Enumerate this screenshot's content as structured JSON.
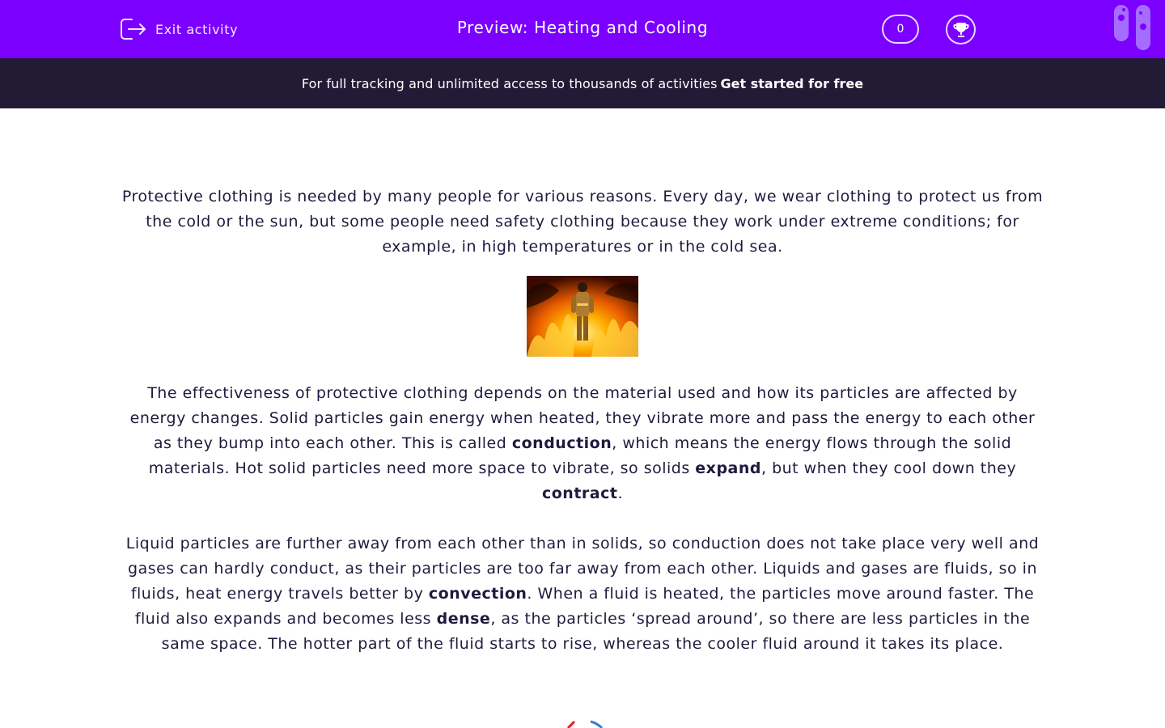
{
  "header": {
    "exit_label": "Exit activity",
    "title": "Preview: Heating and Cooling",
    "score": "0",
    "trophy_icon": "trophy-icon",
    "exit_icon": "exit-icon",
    "bg_color": "#7b00ff"
  },
  "banner": {
    "text": "For full tracking and unlimited access to thousands of activities",
    "cta": "Get started for free",
    "bg_color": "#231b35"
  },
  "content": {
    "para1": "Protective clothing is needed by many people for various reasons. Every day, we wear clothing to protect us from the cold or the sun, but some people need safety clothing because they work under extreme conditions; for example, in high temperatures or in the cold sea.",
    "para2": {
      "t1": "The effectiveness of protective clothing depends on the material used and how its particles are affected by energy changes. Solid particles gain energy when heated, they vibrate more and pass the energy to each other as they bump into each other. This is called ",
      "b1": "conduction",
      "t2": ", which means the energy flows through the solid materials. Hot solid particles need more space to vibrate, so solids ",
      "b2": "expand",
      "t3": ", but when they cool down they ",
      "b3": "contract",
      "t4": "."
    },
    "para3": {
      "t1": "Liquid particles are further away from each other than in solids, so conduction does not take place very well and gases can hardly conduct, as their particles are too far away from each other. Liquids and gases are fluids, so in fluids, heat energy travels better by ",
      "b1": "convection",
      "t2": ". When a fluid is heated, the particles move around faster. The fluid also expands and becomes less ",
      "b2": "dense",
      "t3": ", as the particles ‘spread around’, so there are less particles in the same space. The hotter part of the fluid starts to rise, whereas the cooler fluid around it takes its place."
    }
  }
}
